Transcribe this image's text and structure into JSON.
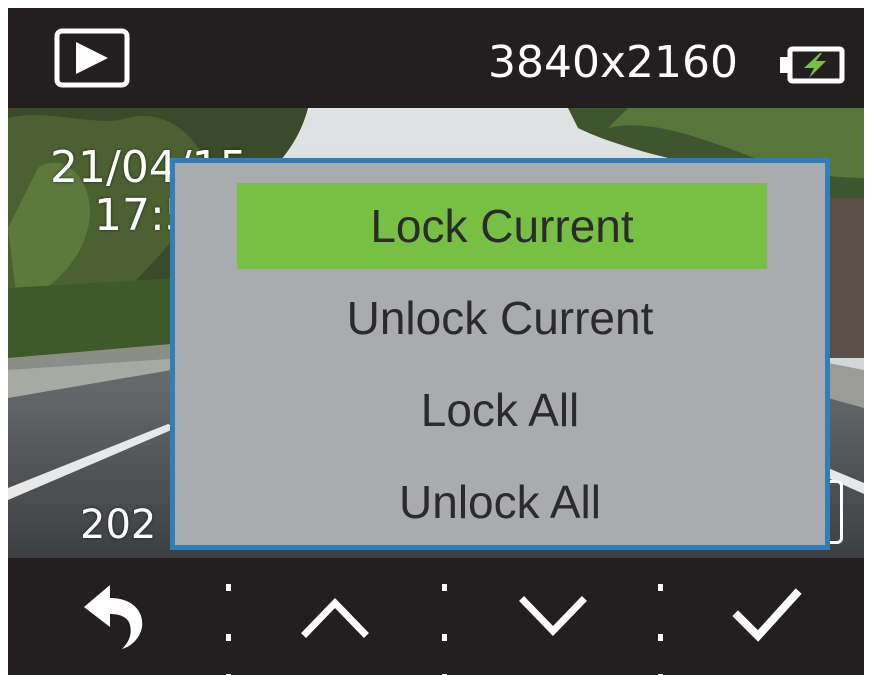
{
  "status_bar": {
    "mode_icon": "playback-icon",
    "resolution": "3840x2160",
    "battery_icon": "battery-charging-icon"
  },
  "preview": {
    "date": "21/04/15",
    "time": "17:5",
    "timestamp": "202"
  },
  "menu": {
    "items": [
      {
        "label": "Lock Current",
        "selected": true
      },
      {
        "label": "Unlock Current",
        "selected": false
      },
      {
        "label": "Lock All",
        "selected": false
      },
      {
        "label": "Unlock All",
        "selected": false
      }
    ]
  },
  "bottom_bar": {
    "buttons": [
      {
        "icon": "back-arrow-icon"
      },
      {
        "icon": "chevron-up-icon"
      },
      {
        "icon": "chevron-down-icon"
      },
      {
        "icon": "checkmark-icon"
      }
    ]
  },
  "colors": {
    "background": "#231f20",
    "menu_background": "#a9abae",
    "menu_border": "#2f7fb8",
    "selection": "#78c044",
    "battery_bolt": "#78c044"
  }
}
